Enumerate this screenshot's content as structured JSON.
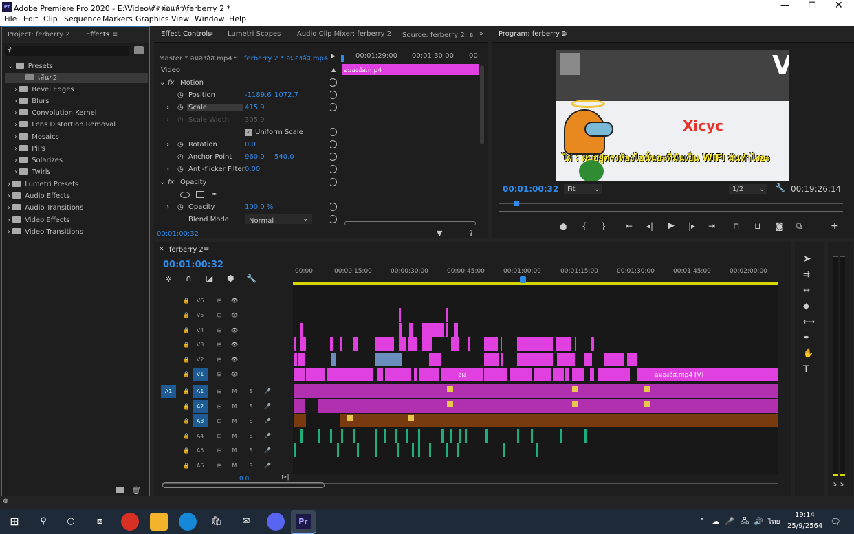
{
  "window": {
    "title": "Adobe Premiere Pro 2020 - E:\\Video\\ตัดต่อแล้ว\\ferberry 2 *",
    "app_icon": "Pr"
  },
  "menu": [
    "File",
    "Edit",
    "Clip",
    "Sequence",
    "Markers",
    "Graphics",
    "View",
    "Window",
    "Help"
  ],
  "left_panel": {
    "tab_project": "Project: ferberry 2",
    "tab_effects": "Effects",
    "tree": [
      "Presets",
      "เส้นๆ2",
      "Bevel Edges",
      "Blurs",
      "Convolution Kernel",
      "Lens Distortion Removal",
      "Mosaics",
      "PiPs",
      "Solarizes",
      "Twirls",
      "Lumetri Presets",
      "Audio Effects",
      "Audio Transitions",
      "Video Effects",
      "Video Transitions"
    ]
  },
  "effect_controls": {
    "tabs": [
      "Effect Controls",
      "Lumetri Scopes",
      "Audio Clip Mixer: ferberry 2",
      "Source: ferberry 2: อ"
    ],
    "master": "Master * อมองอัส.mp4",
    "sequence": "ferberry 2 * อมองอัส.mp4",
    "ruler": [
      "00:01:29:00",
      "00:01:30:00",
      "00:"
    ],
    "clip_label": "อมองอัส.mp4",
    "video_label": "Video",
    "motion": "Motion",
    "position_label": "Position",
    "position_x": "-1189.6",
    "position_y": "1072.7",
    "scale_label": "Scale",
    "scale_value": "415.9",
    "scale_width_label": "Scale Width",
    "scale_width_value": "305.9",
    "uniform_scale": "Uniform Scale",
    "rotation_label": "Rotation",
    "rotation_value": "0.0",
    "anchor_label": "Anchor Point",
    "anchor_x": "960.0",
    "anchor_y": "540.0",
    "antiflicker_label": "Anti-flicker Filter",
    "antiflicker_value": "0.00",
    "opacity_section": "Opacity",
    "opacity_label": "Opacity",
    "opacity_value": "100.0 %",
    "blend_label": "Blend Mode",
    "blend_value": "Normal",
    "timecode": "00:01:00:32"
  },
  "program": {
    "title": "Program: ferberry 2",
    "timecode": "00:01:00:32",
    "fit": "Fit",
    "resolution": "1/2",
    "duration": "00:19:26:14",
    "frame_text_name": "Xicyc",
    "frame_subtitle": "ไผ่ : ผมอยู่ตรงห้องไอนั่นอะที่มันเป็น WIFI มันทำไงอะ"
  },
  "timeline": {
    "tab": "ferberry 2",
    "timecode": "00:01:00:32",
    "ruler": [
      ":00:00",
      "00:00:15:00",
      "00:00:30:00",
      "00:00:45:00",
      "00:01:00:00",
      "00:01:15:00",
      "00:01:30:00",
      "00:01:45:00",
      "00:02:00:00"
    ],
    "video_tracks": [
      "V6",
      "V5",
      "V4",
      "V3",
      "V2",
      "V1"
    ],
    "audio_tracks": [
      "A1",
      "A2",
      "A3",
      "A4",
      "A5",
      "A6"
    ],
    "source_patch": "A1",
    "v1_clip_label": "อมองอัส.mp4 [V]",
    "v1_small_label": "อม",
    "mix_value": "0.0"
  },
  "meters": {
    "labels": [
      "S",
      "S"
    ]
  },
  "taskbar": {
    "time": "19:14",
    "date": "25/9/2564",
    "lang": "ไทย"
  },
  "colors": {
    "accent": "#2d8ceb",
    "clip_video": "#e040e0",
    "clip_audio": "#b030b0",
    "clip_a3": "#7a3a10",
    "clip_green": "#1fae7a"
  }
}
